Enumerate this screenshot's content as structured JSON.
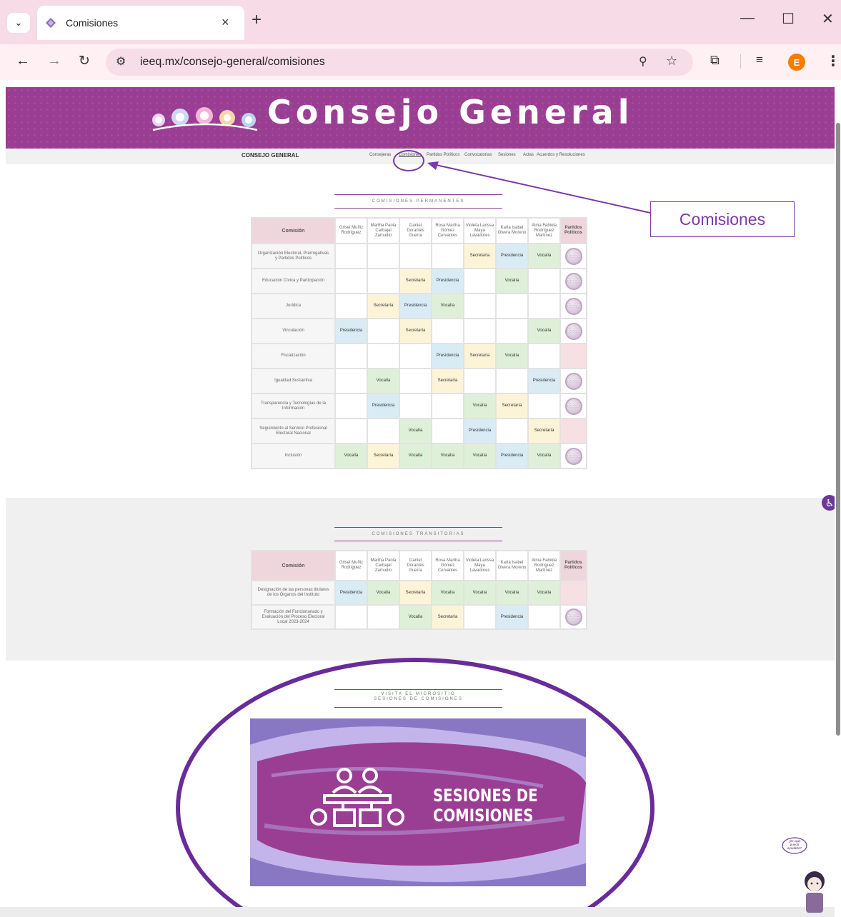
{
  "browser": {
    "tab_title": "Comisiones",
    "tab_close": "×",
    "new_tab": "+",
    "url": "ieeq.mx/consejo-general/comisiones",
    "profile_initial": "E",
    "window_controls": [
      "—",
      "☐",
      "✕"
    ],
    "icons": [
      "chevron-down-icon",
      "favicon",
      "close-icon",
      "plus-icon",
      "back-icon",
      "forward-icon",
      "reload-icon",
      "site-settings-icon",
      "zoom-icon",
      "star-icon",
      "extensions-icon",
      "media-icon",
      "menu-icon"
    ]
  },
  "banner": {
    "title": "Consejo General"
  },
  "nav": {
    "brand": "CONSEJO GENERAL",
    "items": [
      "Consejeras",
      "Comisiones",
      "Partidos Políticos",
      "Convocatorias",
      "Sesiones",
      "Actas",
      "Acuerdos y Resoluciones"
    ]
  },
  "annotation": {
    "callout": "Comisiones",
    "color": "#7b3aa8"
  },
  "permanentes": {
    "heading": "COMISIONES PERMANENTES",
    "header_comision": "Comisión",
    "header_pp": "Partidos Políticos",
    "members": [
      "Grisel Muñiz Rodríguez",
      "Martha Paola Carbajal Zamudio",
      "Daniel Dorantes Guerra",
      "Rosa Martha Gómez Cervantes",
      "Violeta Larissa Maya Lavadores",
      "Karla Isabel Olvera Moreno",
      "Alma Fabiola Rodríguez Martínez"
    ],
    "rows": [
      {
        "name": "Organización Electoral, Prerrogativas y Partidos Políticos",
        "cells": [
          "",
          "",
          "",
          "",
          "Secretaría",
          "Presidencia",
          "Vocalía"
        ],
        "pp": "TODOS"
      },
      {
        "name": "Educación Cívica y Participación",
        "cells": [
          "",
          "",
          "Secretaría",
          "Presidencia",
          "",
          "Vocalía",
          ""
        ],
        "pp": "TODOS"
      },
      {
        "name": "Jurídica",
        "cells": [
          "",
          "Secretaría",
          "Presidencia",
          "Vocalía",
          "",
          "",
          ""
        ],
        "pp": "TODOS"
      },
      {
        "name": "Vinculación",
        "cells": [
          "Presidencia",
          "",
          "Secretaría",
          "",
          "",
          "",
          "Vocalía"
        ],
        "pp": "TODOS"
      },
      {
        "name": "Fiscalización",
        "cells": [
          "",
          "",
          "",
          "Presidencia",
          "Secretaría",
          "Vocalía",
          ""
        ],
        "pp": ""
      },
      {
        "name": "Igualdad Sustantiva",
        "cells": [
          "",
          "Vocalía",
          "",
          "Secretaría",
          "",
          "",
          "Presidencia"
        ],
        "pp": "TODOS"
      },
      {
        "name": "Transparencia y Tecnologías de la Información",
        "cells": [
          "",
          "Presidencia",
          "",
          "",
          "Vocalía",
          "Secretaría",
          ""
        ],
        "pp": "TODOS"
      },
      {
        "name": "Seguimiento al Servicio Profesional Electoral Nacional",
        "cells": [
          "",
          "",
          "Vocalía",
          "",
          "Presidencia",
          "",
          "Secretaría"
        ],
        "pp": ""
      },
      {
        "name": "Inclusión",
        "cells": [
          "Vocalía",
          "Secretaría",
          "Vocalía",
          "Vocalía",
          "Vocalía",
          "Presidencia",
          "Vocalía"
        ],
        "pp": "TODOS"
      }
    ]
  },
  "transitorias": {
    "heading": "COMISIONES TRANSITORIAS",
    "header_comision": "Comisión",
    "header_pp": "Partidos Políticos",
    "members": [
      "Grisel Muñiz Rodríguez",
      "Martha Paola Carbajal Zamudio",
      "Daniel Dorantes Guerra",
      "Rosa Martha Gómez Cervantes",
      "Violeta Larissa Maya Lavadores",
      "Karla Isabel Olvera Moreno",
      "Alma Fabiola Rodríguez Martínez"
    ],
    "rows": [
      {
        "name": "Designación de las personas titulares de los Órganos del Instituto",
        "cells": [
          "Presidencia",
          "Vocalía",
          "Secretaría",
          "Vocalía",
          "Vocalía",
          "Vocalía",
          "Vocalía"
        ],
        "pp": ""
      },
      {
        "name": "Formación del Funcionariado y Evaluación del Proceso Electoral Local 2023-2024",
        "cells": [
          "",
          "",
          "Vocalía",
          "Secretaría",
          "",
          "Presidencia",
          ""
        ],
        "pp": "TODOS"
      }
    ]
  },
  "microsite": {
    "heading_line1": "VISITA EL MICROSITIO",
    "heading_line2": "SESIONES DE COMISIONES",
    "banner_line1": "SESIONES DE",
    "banner_line2": "COMISIONES"
  },
  "helper": {
    "bubble": "¿En qué puedo ayudarte?"
  },
  "colors": {
    "brand": "#9a3e93",
    "annotation": "#6a2b9a"
  }
}
